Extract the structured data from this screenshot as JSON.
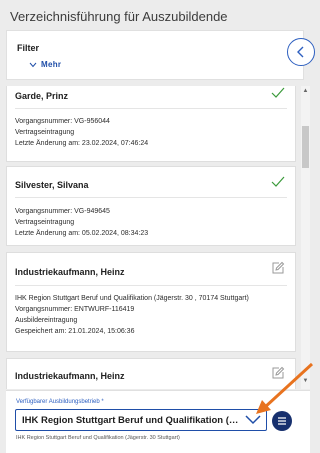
{
  "header": {
    "title": "Verzeichnisführung für Auszubildende"
  },
  "filter": {
    "label": "Filter",
    "more_label": "Mehr"
  },
  "cards": [
    {
      "name": "Garde, Prinz",
      "status": "check-icon",
      "lines": [
        "Vorgangsnummer: VG-956044",
        "Vertragseintragung",
        "Letzte Änderung am: 23.02.2024, 07:46:24"
      ]
    },
    {
      "name": "Silvester, Silvana",
      "status": "check-icon",
      "lines": [
        "Vorgangsnummer: VG-949645",
        "Vertragseintragung",
        "Letzte Änderung am: 05.02.2024, 08:34:23"
      ]
    },
    {
      "name": "Industriekaufmann, Heinz",
      "status": "edit-icon",
      "lines": [
        "IHK Region Stuttgart Beruf und Qualifikation (Jägerstr. 30 , 70174 Stuttgart)",
        "Vorgangsnummer: ENTWURF-116419",
        "Ausbildereintragung",
        "Gespeichert am: 21.01.2024, 15:06:36"
      ]
    },
    {
      "name": "Industriekaufmann, Heinz",
      "status": "edit-icon",
      "lines": []
    }
  ],
  "company_select": {
    "label": "Verfügbarer Ausbildungsbetrieb *",
    "value": "IHK Region Stuttgart Beruf und Qualifikation (Jäger...",
    "helper": "IHK Region Stuttgart Beruf und Qualifikation (Jägerstr. 30 Stuttgart)"
  },
  "colors": {
    "accent": "#2d5fc0",
    "dark_button": "#17306e",
    "check_green": "#3a9a3a",
    "arrow": "#e8731f"
  }
}
